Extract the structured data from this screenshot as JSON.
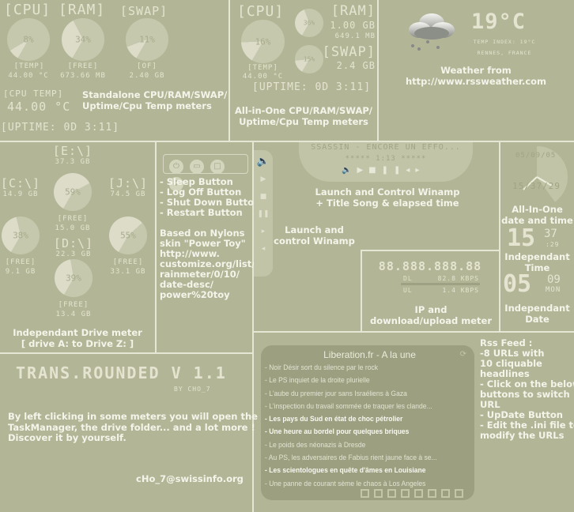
{
  "standalone": {
    "cpu_label": "[CPU]",
    "ram_label": "[RAM]",
    "swap_label": "[SWAP]",
    "cpu_pct": 8,
    "cpu_text": "8%",
    "ram_pct": 34,
    "ram_text": "34%",
    "swap_pct": 11,
    "swap_text": "11%",
    "temp_label": "[TEMP]",
    "temp_value": "44.00 °C",
    "free_label": "[FREE]",
    "free_value": "673.66 MB",
    "of_label": "[OF]",
    "of_value": "2.40 GB",
    "cpu_temp_label": "[CPU TEMP]",
    "cpu_temp_value": "44.00 °C",
    "uptime": "[UPTIME: 0D 3:11]",
    "caption": [
      "Standalone CPU/RAM/SWAP/",
      "Uptime/Cpu Temp meters"
    ]
  },
  "allinone": {
    "cpu_label": "[CPU]",
    "cpu_pct": 16,
    "cpu_text": "16%",
    "ram_pct": 36,
    "ram_text": "36%",
    "swap_pct": 15,
    "swap_text": "15%",
    "ram_label": "[RAM]",
    "ram_total": "1.00 GB",
    "ram_used": "649.1 MB",
    "swap_label": "[SWAP]",
    "swap_total": "2.4 GB",
    "temp_label": "[TEMP]",
    "temp_value": "44.00 °C",
    "uptime": "[UPTIME: 0D 3:11]",
    "caption": [
      "All-in-One CPU/RAM/SWAP/",
      "Uptime/Cpu Temp meters"
    ]
  },
  "weather": {
    "icon": "rain-cloud-icon",
    "temperature": "19°C",
    "temp_index": "TEMP INDEX: 19°C",
    "location": "RENNES, FRANCE",
    "caption": [
      "Weather from",
      "http://www.rssweather.com"
    ]
  },
  "drives": {
    "items": [
      {
        "label": "[E:\\]",
        "size": "37.3 GB",
        "pct": 59,
        "text": "59%",
        "free_label": "[FREE]",
        "free": "15.0 GB"
      },
      {
        "label": "[C:\\]",
        "size": "14.9 GB",
        "pct": 38,
        "text": "38%",
        "free_label": "[FREE]",
        "free": "9.1 GB"
      },
      {
        "label": "[D:\\]",
        "size": "22.3 GB",
        "pct": 39,
        "text": "39%",
        "free_label": "[FREE]",
        "free": "13.4 GB"
      },
      {
        "label": "[J:\\]",
        "size": "74.5 GB",
        "pct": 55,
        "text": "55%",
        "free_label": "[FREE]",
        "free": "33.1 GB"
      }
    ],
    "caption": [
      "Independant Drive meter",
      "[ drive A: to Drive Z: ]"
    ]
  },
  "power": {
    "buttons": [
      "sleep",
      "log-off",
      "shut-down",
      "restart"
    ],
    "lines": [
      "- Sleep Button",
      "- Log Off Button",
      "- Shut Down Button",
      "- Restart Button"
    ],
    "credits": [
      "Based on Nylons",
      "skin \"Power Toy\"",
      "http://www.",
      "customize.org/list/",
      "rainmeter/0/10/",
      "date-desc/",
      "power%20toy"
    ]
  },
  "winamp": {
    "title": "SSASSIN - ENCORE UN EFFO...",
    "elapsed": "***** 1:13 *****",
    "caption": [
      "Launch and Control Winamp",
      "+ Title Song & elapsed time"
    ],
    "side_caption": [
      "Launch and",
      "control Winamp"
    ]
  },
  "clock": {
    "date": "05/09/05",
    "time": "15/37/29",
    "caption": [
      "All-In-One",
      "date and time"
    ],
    "hour": "15",
    "minute": "37",
    "second": ":29",
    "time_caption": [
      "Independant",
      "Time"
    ],
    "day": "05",
    "month": "09",
    "weekday": "MON",
    "date_caption": [
      "Independant",
      "Date"
    ]
  },
  "network": {
    "ip": "88.888.888.88",
    "dl_label": "DL",
    "dl_value": "82.8 KBPS",
    "ul_label": "UL",
    "ul_value": "1.4 KBPS",
    "caption": [
      "IP and",
      "download/upload meter"
    ]
  },
  "rss": {
    "title": "Liberation.fr - A la une",
    "headlines": [
      "- Noir Désir sort du silence par le rock",
      "- Le PS inquiet de la droite plurielle",
      "- L'aube du premier jour sans Israéliens à Gaza",
      "- L'inspection du travail sommée de traquer les clande...",
      "- Les pays du Sud en état de choc pétrolier",
      "- Une heure au bordel pour quelques briques",
      "- Le poids des néonazis à Dresde",
      "- Au PS, les adversaires de Fabius rient jaune face à se...",
      "- Les scientologues en quête d'âmes en Louisiane",
      "- Une panne de courant sème le chaos à Los Angeles"
    ],
    "info": [
      "Rss Feed :",
      "-8 URLs with",
      "10 cliquable",
      "headlines",
      "- Click on the below",
      "buttons to switch",
      "URL",
      "- UpDate Button",
      "- Edit the .ini file to",
      "modify the URLs"
    ]
  },
  "about": {
    "title": "TRANS.ROUNDED V 1.1",
    "author": "BY CHO_7",
    "text": [
      "By left clicking in some meters you will open the",
      "TaskManager, the drive folder... and a lot more !",
      "Discover it by yourself."
    ],
    "email": "cHo_7@swissinfo.org"
  },
  "colors": {
    "background": "#b3b696",
    "pie": "#c6c8ad",
    "pie_fill": "#dcdcc9",
    "text": "#eeeedd"
  }
}
